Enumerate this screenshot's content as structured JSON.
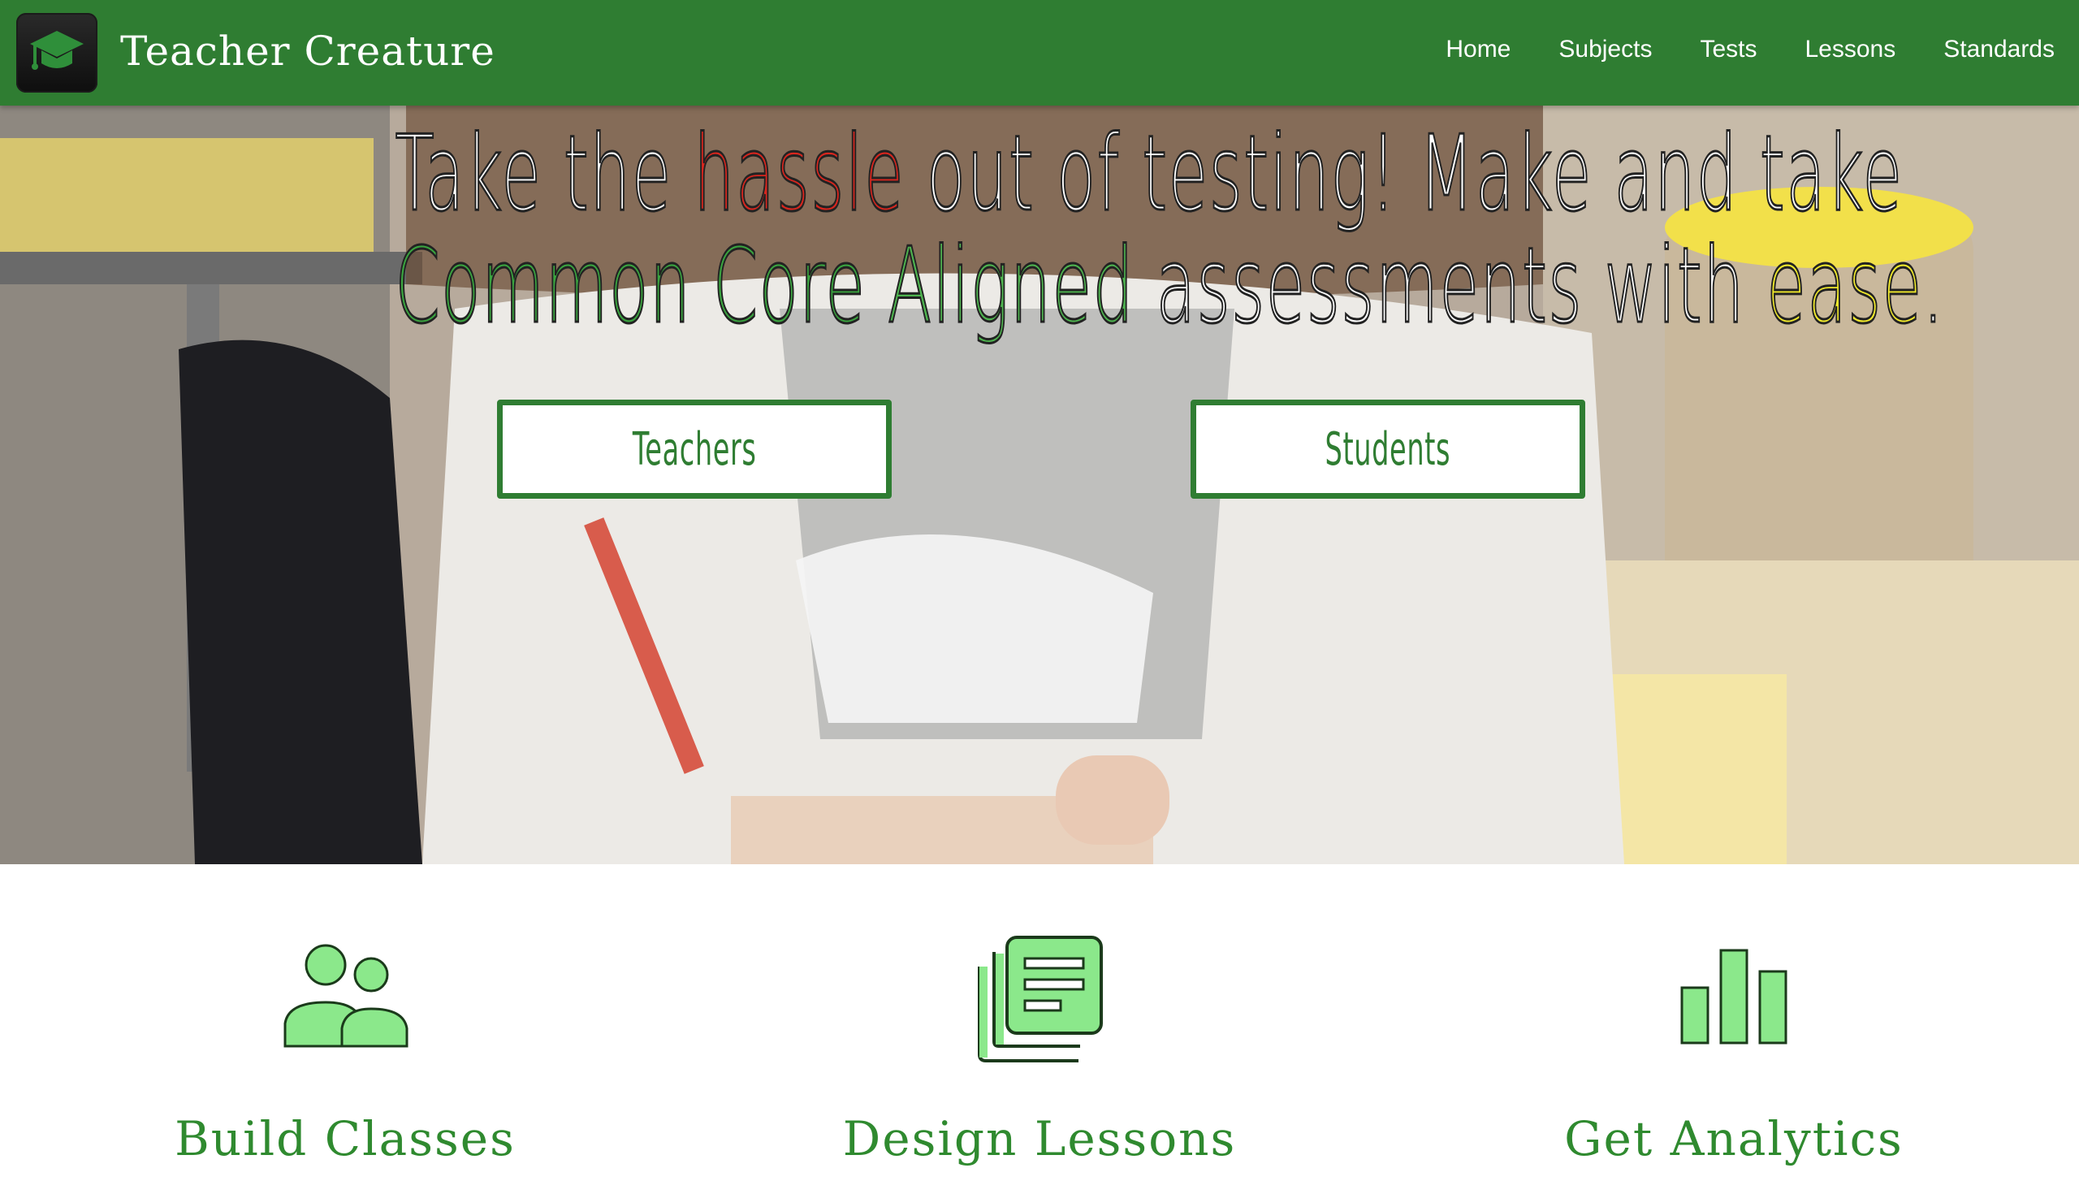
{
  "navbar": {
    "logo_icon": "graduation-cap-icon",
    "brand": "Teacher Creature",
    "links": [
      "Home",
      "Subjects",
      "Tests",
      "Lessons",
      "Standards"
    ]
  },
  "hero": {
    "line1": {
      "before": "Take the ",
      "highlight": "hassle",
      "after": " out of testing! Make and take"
    },
    "line2": {
      "green1": "Common Core",
      "sep": " ",
      "green2": "Aligned",
      "middle": " assessments with ",
      "yellow": "ease",
      "end": "."
    },
    "buttons": {
      "teachers": "Teachers",
      "students": "Students"
    }
  },
  "features": [
    {
      "icon": "people-icon",
      "title": "Build Classes"
    },
    {
      "icon": "document-stack-icon",
      "title": "Design Lessons"
    },
    {
      "icon": "bar-chart-icon",
      "title": "Get Analytics"
    }
  ],
  "colors": {
    "primary_green": "#2f7d32",
    "accent_red": "#d8261e",
    "accent_yellow": "#f1ea2c",
    "icon_fill": "#8be88b"
  }
}
